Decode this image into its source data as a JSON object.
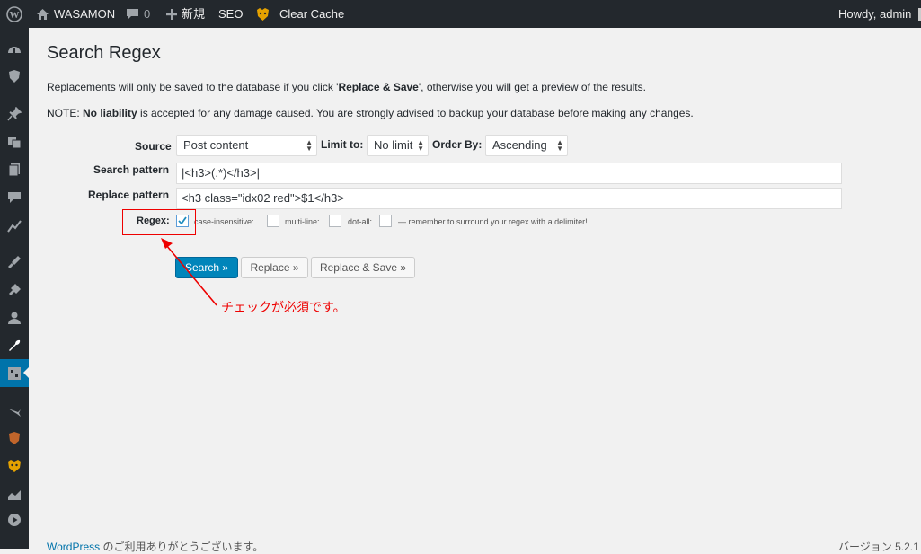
{
  "admin_bar": {
    "site_name": "WASAMON",
    "comment_count": "0",
    "new_label": "新規",
    "seo_label": "SEO",
    "clear_cache_label": "Clear Cache",
    "greeting": "Howdy, admin"
  },
  "page": {
    "title": "Search Regex",
    "note1_pre": "Replacements will only be saved to the database if you click '",
    "note1_bold": "Replace & Save",
    "note1_post": "', otherwise you will get a preview of the results.",
    "note2_pre": "NOTE: ",
    "note2_bold": "No liability",
    "note2_post": " is accepted for any damage caused. You are strongly advised to backup your database before making any changes."
  },
  "form": {
    "source_label": "Source",
    "source_value": "Post content",
    "limit_label": "Limit to:",
    "limit_value": "No limit",
    "order_label": "Order By:",
    "order_value": "Ascending",
    "search_label": "Search pattern",
    "search_value": "|<h3>(.*)</h3>|",
    "replace_label": "Replace pattern",
    "replace_value": "<h3 class=\"idx02 red\">$1</h3>",
    "regex_label": "Regex:",
    "case_label": "case-insensitive:",
    "multiline_label": "multi-line:",
    "dotall_label": "dot-all:",
    "delimiter_note": "— remember to surround your regex with a delimiter!",
    "regex_checked": true
  },
  "buttons": {
    "search": "Search »",
    "replace": "Replace »",
    "replace_save": "Replace & Save »"
  },
  "annotation": {
    "text": "チェックが必須です。",
    "color": "#e00000"
  },
  "footer": {
    "link": "WordPress",
    "thanks": " のご利用ありがとうございます。",
    "version": "バージョン 5.2.1"
  },
  "colors": {
    "adminbar": "#23282d",
    "primary_button": "#0085ba",
    "active_menu": "#0073aa"
  }
}
